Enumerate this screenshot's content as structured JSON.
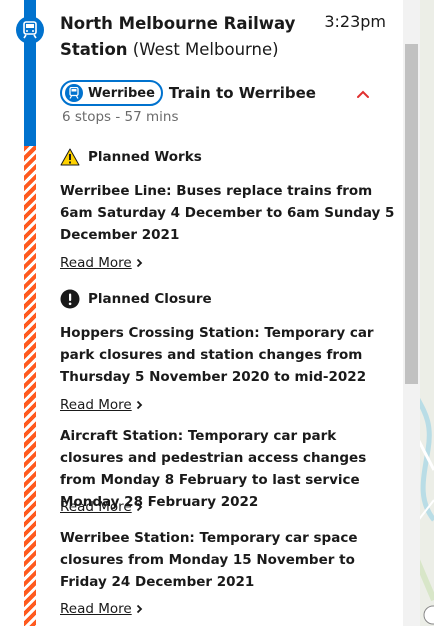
{
  "station": {
    "name": "North Melbourne Railway Station",
    "suburb": "(West Melbourne)",
    "time": "3:23pm"
  },
  "route": {
    "badge": "Werribee",
    "destination": "Train to Werribee",
    "stops": "6 stops - 57 mins"
  },
  "alerts": [
    {
      "type": "Planned Works",
      "icon": "warning-icon",
      "text": "Werribee Line: Buses replace trains from 6am Saturday 4 December to 6am Sunday 5 December 2021",
      "link": "Read More"
    },
    {
      "type": "Planned Closure",
      "icon": "exclamation-icon",
      "text": "Hoppers Crossing Station: Temporary car park closures and station changes from Thursday 5 November 2020 to mid-2022",
      "link": "Read More"
    },
    {
      "text": "Aircraft Station: Temporary car park closures and pedestrian access changes from Monday 8 February to last service Monday 28 February 2022",
      "link": "Read More"
    },
    {
      "text": "Werribee Station: Temporary car space closures from Monday 15 November to Friday 24 December 2021",
      "link": "Read More"
    }
  ],
  "colors": {
    "line_blue": "#0072ce",
    "disruption_orange": "#ff5a1f",
    "warning_yellow": "#ffd200"
  }
}
